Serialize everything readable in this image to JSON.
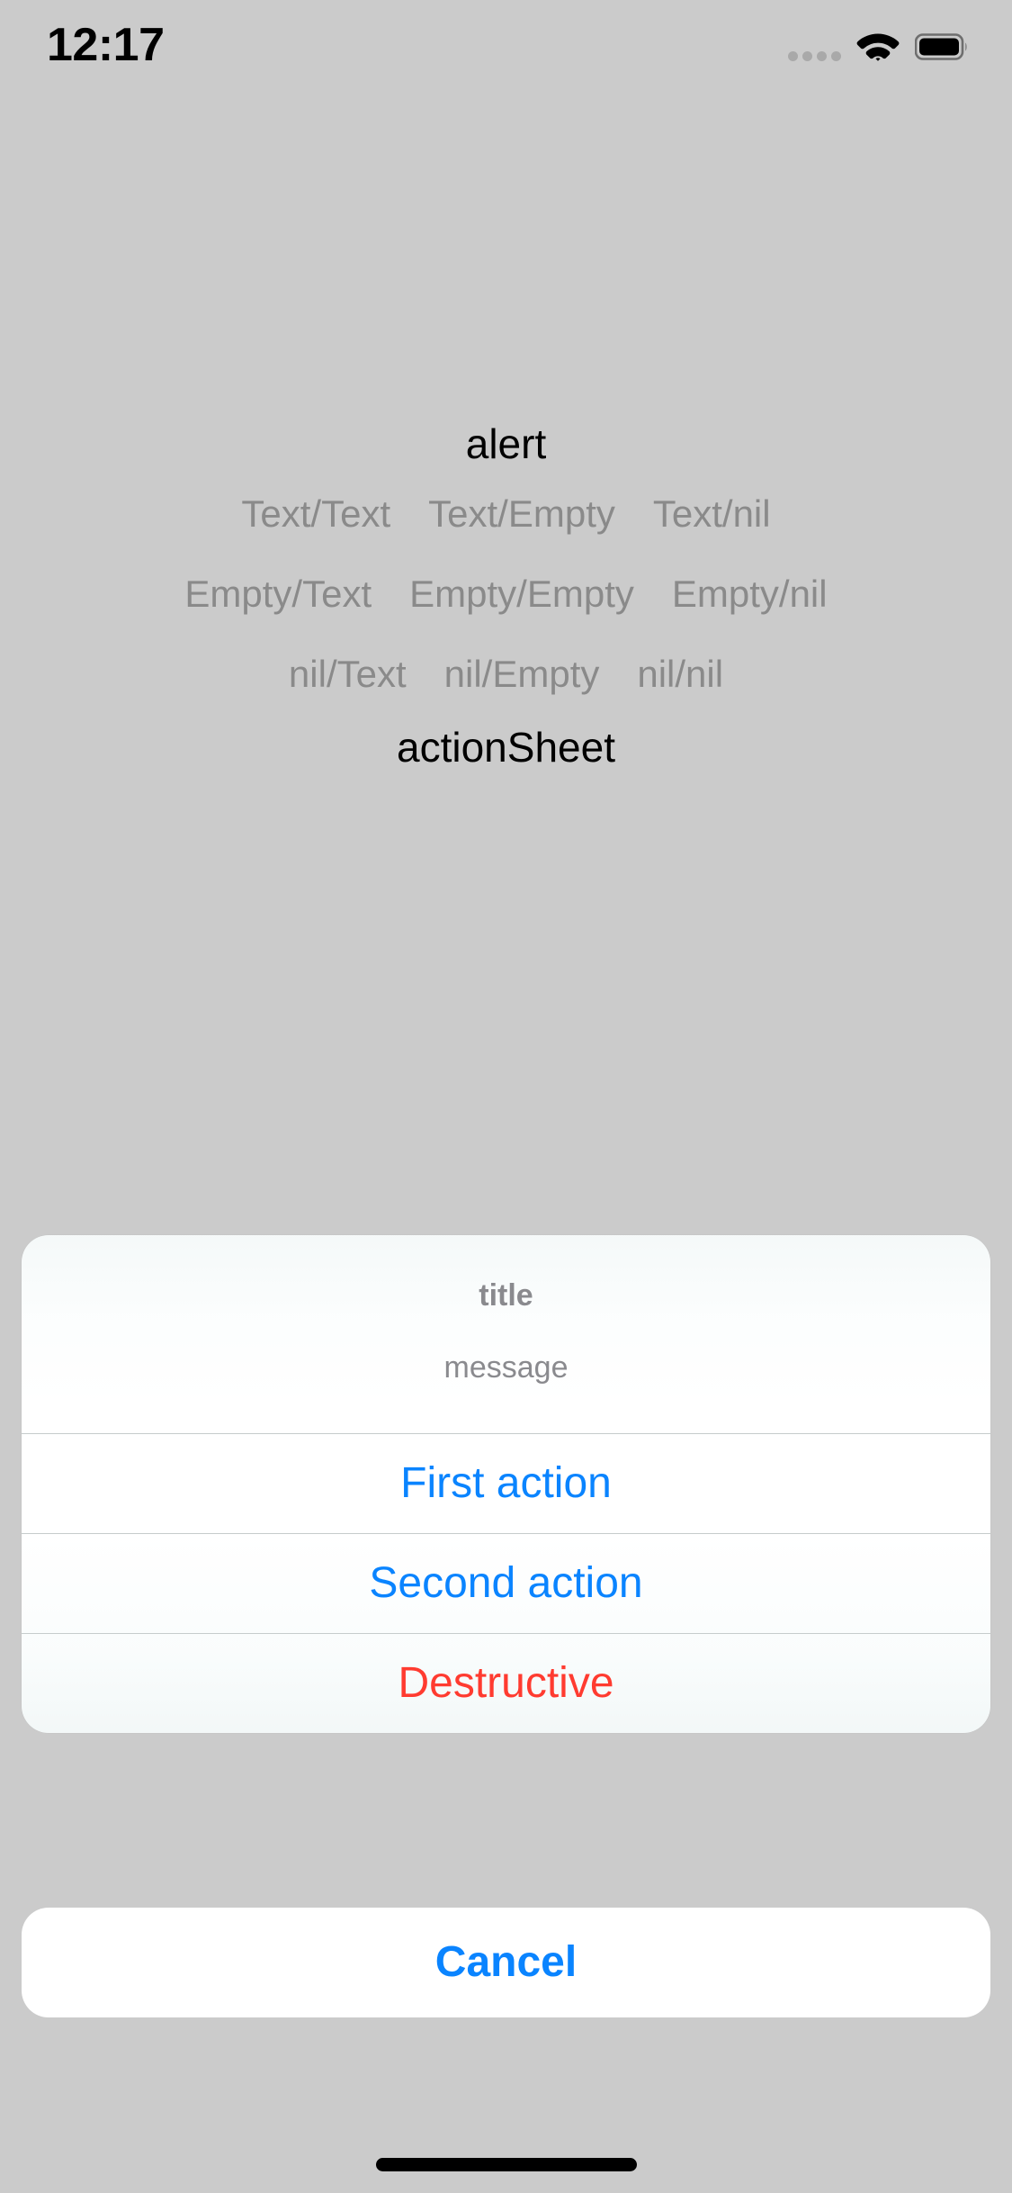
{
  "status_bar": {
    "time": "12:17",
    "icons": {
      "signal": "signal-dots-icon",
      "wifi": "wifi-icon",
      "battery": "battery-full-icon"
    }
  },
  "content": {
    "alert_heading": "alert",
    "actionsheet_heading": "actionSheet",
    "alert_buttons": [
      {
        "label": "Text/Text"
      },
      {
        "label": "Text/Empty"
      },
      {
        "label": "Text/nil"
      },
      {
        "label": "Empty/Text"
      },
      {
        "label": "Empty/Empty"
      },
      {
        "label": "Empty/nil"
      },
      {
        "label": "nil/Text"
      },
      {
        "label": "nil/Empty"
      },
      {
        "label": "nil/nil"
      }
    ]
  },
  "action_sheet": {
    "title": "title",
    "message": "message",
    "actions": [
      {
        "label": "First action",
        "style": "default"
      },
      {
        "label": "Second action",
        "style": "default"
      },
      {
        "label": "Destructive",
        "style": "destructive"
      }
    ],
    "cancel": {
      "label": "Cancel",
      "style": "cancel"
    }
  },
  "colors": {
    "background": "#cbcbcb",
    "accent_blue": "#0a84ff",
    "destructive_red": "#ff3b30",
    "disabled_gray": "#8a8a8a",
    "sheet_label_gray": "#8a8a8e",
    "sheet_white": "#ffffff",
    "separator": "#c6cccc"
  },
  "home_indicator": "home-indicator"
}
